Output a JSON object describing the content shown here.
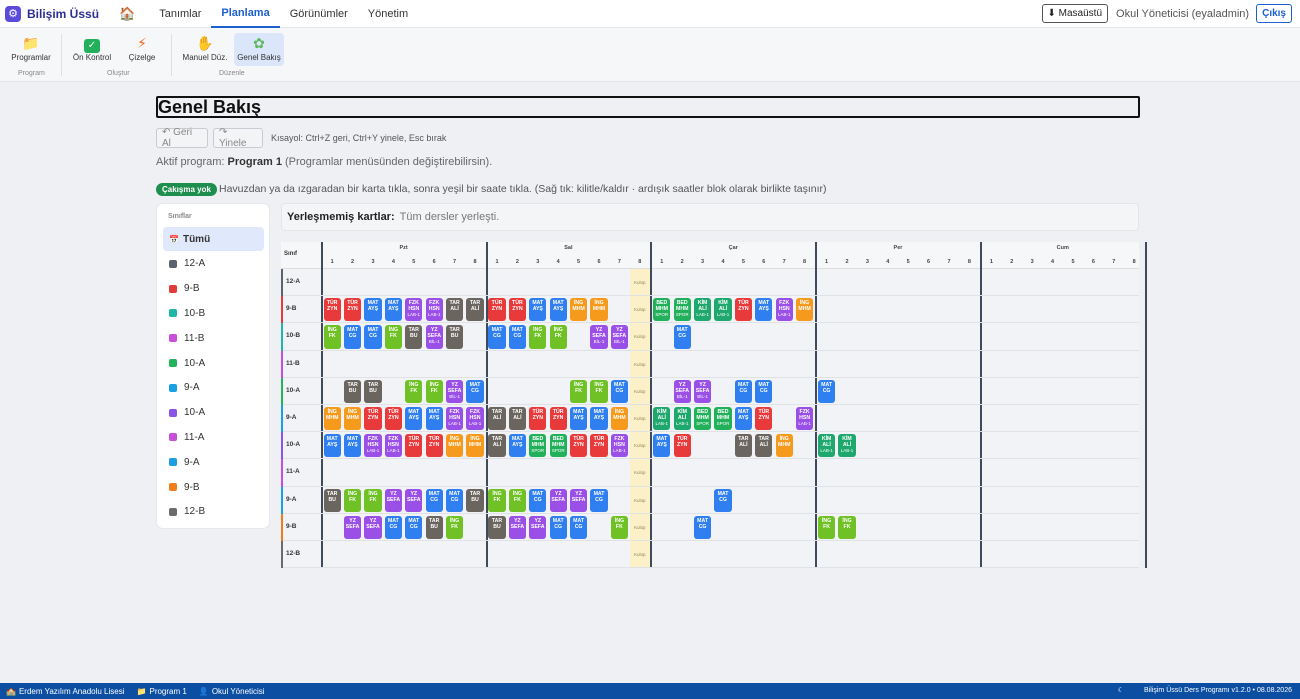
{
  "app": {
    "name": "Bilişim Üssü"
  },
  "nav": {
    "tabs": [
      "Tanımlar",
      "Planlama",
      "Görünümler",
      "Yönetim"
    ],
    "active": 1
  },
  "user": {
    "desktop_label": "⬇ Masaüstü",
    "name": "Okul Yöneticisi (eyaladmin)",
    "logout_label": "Çıkış"
  },
  "ribbon": {
    "groups": [
      {
        "label": "Program",
        "buttons": [
          {
            "label": "Programlar",
            "icon": "folder-icon"
          }
        ]
      },
      {
        "label": "Oluştur",
        "buttons": [
          {
            "label": "Ön Kontrol",
            "icon": "check-icon"
          },
          {
            "label": "Çizelge",
            "icon": "lightning-icon"
          }
        ]
      },
      {
        "label": "Düzenle",
        "buttons": [
          {
            "label": "Manuel Düz.",
            "icon": "hand-icon"
          },
          {
            "label": "Genel Bakış",
            "icon": "puzzle-icon"
          }
        ]
      }
    ]
  },
  "page": {
    "title": "Genel Bakış",
    "undo_label": "↶ Geri Al",
    "redo_label": "↷ Yinele",
    "shortcut": "Kısayol: Ctrl+Z geri, Ctrl+Y yinele, Esc bırak",
    "active_prefix": "Aktif program:",
    "active_program": "Program 1",
    "active_suffix": "(Programlar menüsünden değiştirebilirsin).",
    "conflict_badge": "Çakışma yok",
    "hint": "Havuzdan ya da ızgaradan bir karta tıkla, sonra yeşil bir saate tıkla. (Sağ tık: kilitle/kaldır · ardışık saatler blok olarak birlikte taşınır)",
    "pool_label": "Yerleşmemiş kartlar:",
    "pool_value": "Tüm dersler yerleşti."
  },
  "sidebar": {
    "heading": "Sınıflar",
    "items": [
      {
        "label": "Tümü",
        "color": "",
        "icon": "calendar-icon"
      },
      {
        "label": "12-A",
        "color": "#5c6270"
      },
      {
        "label": "9-B",
        "color": "#e23b3b"
      },
      {
        "label": "10-B",
        "color": "#1fb5a8"
      },
      {
        "label": "11-B",
        "color": "#c84fd8"
      },
      {
        "label": "10-A",
        "color": "#22b45a"
      },
      {
        "label": "9-A",
        "color": "#1aa0e0"
      },
      {
        "label": "10-A",
        "color": "#8a54e6"
      },
      {
        "label": "11-A",
        "color": "#c84fd8"
      },
      {
        "label": "9-A",
        "color": "#1aa0e0"
      },
      {
        "label": "9-B",
        "color": "#f07d1c"
      },
      {
        "label": "12-B",
        "color": "#6b6b6b"
      }
    ]
  },
  "grid": {
    "class_header": "Sınıf",
    "days": [
      "Pzt",
      "Sal",
      "Çar",
      "Per",
      "Cum"
    ],
    "periods": [
      "1",
      "2",
      "3",
      "4",
      "5",
      "6",
      "7",
      "8"
    ],
    "club_label": "Kulüp",
    "rows": [
      {
        "label": "12-A",
        "color": "#5c6270",
        "cells": [
          "",
          "",
          "",
          "",
          "",
          "",
          "",
          "",
          "",
          "",
          "",
          "",
          "",
          "",
          "",
          "",
          "",
          "",
          "",
          "",
          "",
          "",
          "",
          "",
          "",
          "",
          "",
          "",
          "",
          "",
          "",
          "",
          "",
          "",
          "",
          "",
          "",
          "",
          "",
          ""
        ]
      },
      {
        "label": "9-B",
        "color": "#e23b3b",
        "cells": [
          "TÜR|ZYN",
          "TÜR|ZYN",
          "MAT|AYŞ",
          "MAT|AYŞ",
          "FZK|HSN|LAB-1",
          "FZK|HSN|LAB-1",
          "TAR|ALİ",
          "TAR|ALİ",
          "TÜR|ZYN",
          "TÜR|ZYN",
          "MAT|AYŞ",
          "MAT|AYŞ",
          "İNG|MHM",
          "İNG|MHM",
          "",
          "",
          "BED|MHM|SPOR",
          "BED|MHM|SPOR",
          "KİM|ALİ|LAB-1",
          "KİM|ALİ|LAB-1",
          "TÜR|ZYN",
          "MAT|AYŞ",
          "FZK|HSN|LAB-1",
          "İNG|MHM",
          "",
          "",
          "",
          "",
          "",
          "",
          "",
          "",
          "",
          "",
          "",
          "",
          "",
          "",
          "",
          ""
        ]
      },
      {
        "label": "10-B",
        "color": "#1fb5a8",
        "cells": [
          "İNG|FK",
          "MAT|CG",
          "MAT|CG",
          "İNG|FK",
          "TAR|BU",
          "YZ|SEFA|BİL-1",
          "TAR|BU",
          "",
          "MAT|CG",
          "MAT|CG",
          "İNG|FK",
          "İNG|FK",
          "",
          "YZ|SEFA|BİL-1",
          "YZ|SEFA|BİL-1",
          "",
          "",
          "MAT|CG",
          "",
          "",
          "",
          "",
          "",
          "",
          "",
          "",
          "",
          "",
          "",
          "",
          "",
          "",
          "",
          "",
          "",
          "",
          "",
          "",
          "",
          ""
        ]
      },
      {
        "label": "11-B",
        "color": "#c84fd8",
        "cells": [
          "",
          "",
          "",
          "",
          "",
          "",
          "",
          "",
          "",
          "",
          "",
          "",
          "",
          "",
          "",
          "",
          "",
          "",
          "",
          "",
          "",
          "",
          "",
          "",
          "",
          "",
          "",
          "",
          "",
          "",
          "",
          "",
          "",
          "",
          "",
          "",
          "",
          "",
          "",
          ""
        ]
      },
      {
        "label": "10-A",
        "color": "#22b45a",
        "cells": [
          "",
          "TAR|BU",
          "TAR|BU",
          "",
          "İNG|FK",
          "İNG|FK",
          "YZ|SEFA|BİL-1",
          "MAT|CG",
          "",
          "",
          "",
          "",
          "İNG|FK",
          "İNG|FK",
          "MAT|CG",
          "",
          "",
          "YZ|SEFA|BİL-1",
          "YZ|SEFA|BİL-1",
          "",
          "MAT|CG",
          "MAT|CG",
          "",
          "",
          "MAT|CG",
          "",
          "",
          "",
          "",
          "",
          "",
          "",
          "",
          "",
          "",
          "",
          "",
          "",
          "",
          ""
        ]
      },
      {
        "label": "9-A",
        "color": "#1aa0e0",
        "cells": [
          "İNG|MHM",
          "İNG|MHM",
          "TÜR|ZYN",
          "TÜR|ZYN",
          "MAT|AYŞ",
          "MAT|AYŞ",
          "FZK|HSN|LAB-1",
          "FZK|HSN|LAB-1",
          "TAR|ALİ",
          "TAR|ALİ",
          "TÜR|ZYN",
          "TÜR|ZYN",
          "MAT|AYŞ",
          "MAT|AYŞ",
          "İNG|MHM",
          "",
          "KİM|ALİ|LAB-1",
          "KİM|ALİ|LAB-1",
          "BED|MHM|SPOR",
          "BED|MHM|SPOR",
          "MAT|AYŞ",
          "TÜR|ZYN",
          "",
          "FZK|HSN|LAB-1",
          "",
          "",
          "",
          "",
          "",
          "",
          "",
          "",
          "",
          "",
          "",
          "",
          "",
          "",
          "",
          ""
        ]
      },
      {
        "label": "10-A",
        "color": "#8a54e6",
        "cells": [
          "MAT|AYŞ",
          "MAT|AYŞ",
          "FZK|HSN|LAB-1",
          "FZK|HSN|LAB-1",
          "TÜR|ZYN",
          "TÜR|ZYN",
          "İNG|MHM",
          "İNG|MHM",
          "TAR|ALİ",
          "MAT|AYŞ",
          "BED|MHM|SPOR",
          "BED|MHM|SPOR",
          "TÜR|ZYN",
          "TÜR|ZYN",
          "FZK|HSN|LAB-1",
          "",
          "MAT|AYŞ",
          "TÜR|ZYN",
          "",
          "",
          "TAR|ALİ",
          "TAR|ALİ",
          "İNG|MHM",
          "",
          "KİM|ALİ|LAB-1",
          "KİM|ALİ|LAB-1",
          "",
          "",
          "",
          "",
          "",
          "",
          "",
          "",
          "",
          "",
          "",
          "",
          "",
          ""
        ]
      },
      {
        "label": "11-A",
        "color": "#c84fd8",
        "cells": [
          "",
          "",
          "",
          "",
          "",
          "",
          "",
          "",
          "",
          "",
          "",
          "",
          "",
          "",
          "",
          "",
          "",
          "",
          "",
          "",
          "",
          "",
          "",
          "",
          "",
          "",
          "",
          "",
          "",
          "",
          "",
          "",
          "",
          "",
          "",
          "",
          "",
          "",
          "",
          ""
        ]
      },
      {
        "label": "9-A",
        "color": "#1aa0e0",
        "cells": [
          "TAR|BU",
          "İNG|FK",
          "İNG|FK",
          "YZ|SEFA",
          "YZ|SEFA",
          "MAT|CG",
          "MAT|CG",
          "TAR|BU",
          "İNG|FK",
          "İNG|FK",
          "MAT|CG",
          "YZ|SEFA",
          "YZ|SEFA",
          "MAT|CG",
          "",
          "",
          "",
          "",
          "",
          "MAT|CG",
          "",
          "",
          "",
          "",
          "",
          "",
          "",
          "",
          "",
          "",
          "",
          "",
          "",
          "",
          "",
          "",
          "",
          "",
          "",
          ""
        ]
      },
      {
        "label": "9-B",
        "color": "#f07d1c",
        "cells": [
          "",
          "YZ|SEFA",
          "YZ|SEFA",
          "MAT|CG",
          "MAT|CG",
          "TAR|BU",
          "İNG|FK",
          "",
          "TAR|BU",
          "YZ|SEFA",
          "YZ|SEFA",
          "MAT|CG",
          "MAT|CG",
          "",
          "İNG|FK",
          "",
          "",
          "",
          "MAT|CG",
          "",
          "",
          "",
          "",
          "",
          "İNG|FK",
          "İNG|FK",
          "",
          "",
          "",
          "",
          "",
          "",
          "",
          "",
          "",
          "",
          "",
          "",
          "",
          ""
        ]
      },
      {
        "label": "12-B",
        "color": "#6b6b6b",
        "cells": [
          "",
          "",
          "",
          "",
          "",
          "",
          "",
          "",
          "",
          "",
          "",
          "",
          "",
          "",
          "",
          "",
          "",
          "",
          "",
          "",
          "",
          "",
          "",
          "",
          "",
          "",
          "",
          "",
          "",
          "",
          "",
          "",
          "",
          "",
          "",
          "",
          "",
          "",
          "",
          ""
        ]
      }
    ]
  },
  "subject_colors": {
    "TÜR": "#e83a3a",
    "MAT": "#2f7ff0",
    "FZK": "#9a4fe6",
    "TAR": "#6b6560",
    "İNG": "#f59a1c",
    "BED": "#22b05a",
    "KİM": "#1fa86e",
    "YZ": "#9a4fe6",
    "İNGFK": "#6fc126"
  },
  "status": {
    "school": "Erdem Yazılım Anadolu Lisesi",
    "program": "Program 1",
    "user": "Okul Yöneticisi",
    "right": "Bilişim Üssü Ders Programı v1.2.0 • 08.08.2026",
    "theme_icon": "moon-icon"
  }
}
